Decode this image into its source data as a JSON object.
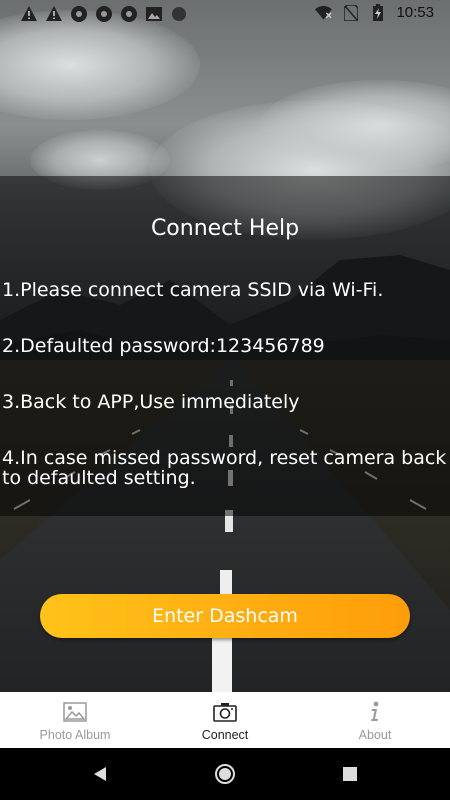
{
  "status_bar": {
    "time": "10:53",
    "left_icons": [
      "warning-icon",
      "warning-icon",
      "aperture-icon",
      "aperture-icon",
      "aperture-icon",
      "image-icon",
      "circle-icon"
    ],
    "right_icons": [
      "wifi-off-icon",
      "no-sim-icon",
      "battery-charging-icon"
    ]
  },
  "help": {
    "title": "Connect Help",
    "steps": [
      "1.Please connect camera SSID via Wi-Fi.",
      "2.Defaulted password:123456789",
      "3.Back to APP,Use immediately",
      "4.In case missed password, reset camera back to defaulted setting."
    ]
  },
  "enter_button": {
    "label": "Enter Dashcam"
  },
  "bottom_nav": {
    "items": [
      {
        "label": "Photo Album",
        "icon": "photo-icon",
        "active": false
      },
      {
        "label": "Connect",
        "icon": "camera-icon",
        "active": true
      },
      {
        "label": "About",
        "icon": "info-icon",
        "active": false
      }
    ]
  },
  "system_nav": {
    "buttons": [
      "back-icon",
      "home-icon",
      "recents-icon"
    ]
  },
  "colors": {
    "button_start": "#ffc21a",
    "button_end": "#ff9d0a",
    "active_nav": "#222222",
    "inactive_nav": "#9a9a9a"
  }
}
